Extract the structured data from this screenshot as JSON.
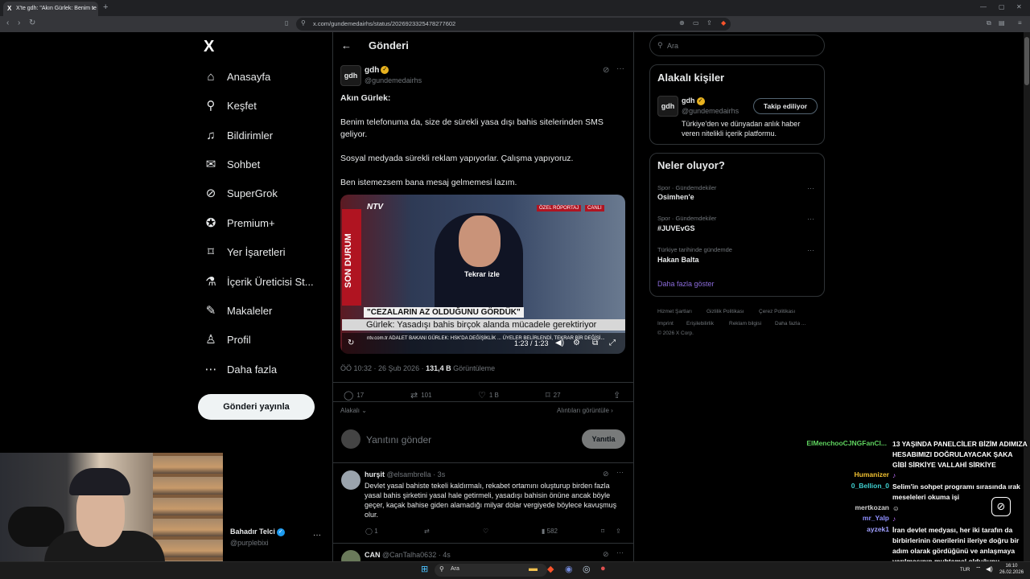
{
  "browser": {
    "tab_title": "X'te gdh: \"Akın Gürlek: Benim te",
    "tab_favicon": "X",
    "tab_close": "×",
    "new_tab": "+",
    "url": "x.com/gundemedairhs/status/2026923325478277602"
  },
  "sidebar": {
    "logo": "X",
    "items": [
      {
        "icon": "home-icon",
        "label": "Anasayfa"
      },
      {
        "icon": "search-icon",
        "label": "Keşfet"
      },
      {
        "icon": "bell-icon",
        "label": "Bildirimler"
      },
      {
        "icon": "mail-icon",
        "label": "Sohbet"
      },
      {
        "icon": "grok-icon",
        "label": "SuperGrok"
      },
      {
        "icon": "premium-icon",
        "label": "Premium+"
      },
      {
        "icon": "bookmark-icon",
        "label": "Yer İşaretleri"
      },
      {
        "icon": "creator-icon",
        "label": "İçerik Üreticisi St..."
      },
      {
        "icon": "article-icon",
        "label": "Makaleler"
      },
      {
        "icon": "profile-icon",
        "label": "Profil"
      },
      {
        "icon": "more-circle-icon",
        "label": "Daha fazla"
      }
    ],
    "post_button": "Gönderi yayınla",
    "account_name": "Bahadır Telci",
    "account_handle": "@purplebixi"
  },
  "post": {
    "header_title": "Gönderi",
    "author_avatar": "gdh",
    "author_name": "gdh",
    "author_handle": "@gundemedairhs",
    "lines": [
      "Akın Gürlek:",
      "Benim telefonuma da, size de sürekli yasa dışı bahis sitelerinden SMS geliyor.",
      "Sosyal medyada sürekli reklam yapıyorlar. Çalışma yapıyoruz.",
      "Ben istemezsem bana mesaj gelmemesi lazım."
    ],
    "video": {
      "channel": "NTV",
      "side_banner": "SON DURUM",
      "tag_special": "ÖZEL RÖPORTAJ",
      "tag_live": "CANLI",
      "replay": "Tekrar izle",
      "headline_quote": "\"CEZALARIN AZ OLDUĞUNU GÖRDÜK\"",
      "headline_sub": "Gürlek: Yasadışı bahis birçok alanda mücadele gerektiriyor",
      "ticker": "ntv.com.tr  ADALET BAKANI GÜRLEK: HSK'DA DEĞİŞİKLİK ... ÜYELER BELİRLENDİ, TEKRAR BİR DEĞİŞİ...",
      "time": "1:23 / 1:23"
    },
    "timestamp": "ÖÖ 10:32 · 26 Şub 2026 · ",
    "views_count": "131,4 B",
    "views_label": " Görüntüleme",
    "stats": {
      "replies": "17",
      "reposts": "101",
      "likes": "1 B",
      "bookmarks": "27"
    },
    "sort_label": "Alakalı",
    "quotes_link": "Alıntıları görüntüle",
    "reply_placeholder": "Yanıtını gönder",
    "reply_button": "Yanıtla"
  },
  "replies": [
    {
      "name": "hurşit",
      "handle": "@elsambrella · 3s",
      "text": "Devlet yasal bahiste tekeli kaldırmalı, rekabet ortamını oluşturup birden fazla yasal bahis şirketini yasal hale getirmeli, yasadışı bahisin önüne ancak böyle geçer, kaçak bahise giden alamadığı milyar dolar vergiyede böylece kavuşmuş olur.",
      "replies": "1",
      "views": "582"
    },
    {
      "name": "CAN",
      "handle": "@CanTalha0632 · 4s",
      "text": ""
    }
  ],
  "right": {
    "search_placeholder": "Ara",
    "related_title": "Alakalı kişiler",
    "related": {
      "avatar": "gdh",
      "name": "gdh",
      "handle": "@gundemedairhs",
      "bio": "Türkiye'den ve dünyadan anlık haber veren nitelikli içerik platformu.",
      "follow": "Takip ediliyor"
    },
    "trends_title": "Neler oluyor?",
    "trends": [
      {
        "category": "Spor · Gündemdekiler",
        "name": "Osimhen'e"
      },
      {
        "category": "Spor · Gündemdekiler",
        "name": "#JUVEvGS"
      },
      {
        "category": "Türkiye tarihinde gündemde",
        "name": "Hakan Balta"
      }
    ],
    "show_more": "Daha fazla göster",
    "footer": [
      "Hizmet Şartları",
      "Gizlilik Politikası",
      "Çerez Politikası",
      "Imprint",
      "Erişilebilirlik",
      "Reklam bilgisi",
      "Daha fazla ...",
      "© 2026 X Corp."
    ]
  },
  "chat": [
    {
      "user": "ElMenchooCJNGFanCl...",
      "color": "#5fd35f",
      "msg": "13 YAŞINDA PANELCİLER BİZİM ADIMIZA HESABIMIZI DOĞRULAYACAK ŞAKA GİBİ SİRKİYE VALLAHİ SİRKİYE"
    },
    {
      "user": "Humanizer",
      "color": "#f0c030",
      "msg": ""
    },
    {
      "user": "0_Bellion_0",
      "color": "#3fd0d0",
      "msg": "Selim'in sohpet programı sırasında ırak meseleleri okuma işi"
    },
    {
      "user": "mertkozan",
      "color": "#d0d0d0",
      "msg": ""
    },
    {
      "user": "mr_Yalp",
      "color": "#8f8fff",
      "msg": ""
    },
    {
      "user": "ayzek1",
      "color": "#a0a0ff",
      "msg": "İran devlet medyası, her iki tarafın da birbirlerinin önerilerini ileriye doğru bir adım olarak gördüğünü ve anlaşmaya varılmasının muhtemel olduğunu bildirdi."
    }
  ],
  "taskbar": {
    "search": "Ara",
    "lang": "TUR",
    "time": "16:10",
    "date": "26.02.2026"
  }
}
